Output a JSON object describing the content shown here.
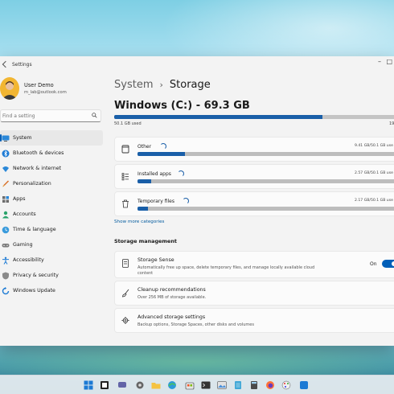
{
  "window": {
    "title": "Settings"
  },
  "user": {
    "name": "User Demo",
    "email": "m_lab@outlook.com"
  },
  "search": {
    "placeholder": "Find a setting"
  },
  "nav": [
    {
      "label": "System",
      "icon": "monitor-icon"
    },
    {
      "label": "Bluetooth & devices",
      "icon": "bluetooth-icon"
    },
    {
      "label": "Network & internet",
      "icon": "wifi-icon"
    },
    {
      "label": "Personalization",
      "icon": "brush-icon"
    },
    {
      "label": "Apps",
      "icon": "apps-icon"
    },
    {
      "label": "Accounts",
      "icon": "person-icon"
    },
    {
      "label": "Time & language",
      "icon": "globe-clock-icon"
    },
    {
      "label": "Gaming",
      "icon": "gamepad-icon"
    },
    {
      "label": "Accessibility",
      "icon": "accessibility-icon"
    },
    {
      "label": "Privacy & security",
      "icon": "shield-icon"
    },
    {
      "label": "Windows Update",
      "icon": "update-icon"
    }
  ],
  "breadcrumb": {
    "parent": "System",
    "separator": "›",
    "current": "Storage"
  },
  "drive": {
    "title": "Windows (C:) - 69.3 GB",
    "used_label": "50.1 GB used",
    "total_label": "19",
    "used_fraction": 0.72
  },
  "categories": [
    {
      "label": "Other",
      "size": "9.41 GB/50.1 GB use",
      "fraction": 0.18,
      "icon": "folder-icon"
    },
    {
      "label": "Installed apps",
      "size": "2.57 GB/50.1 GB use",
      "fraction": 0.05,
      "icon": "list-icon"
    },
    {
      "label": "Temporary files",
      "size": "2.17 GB/50.1 GB use",
      "fraction": 0.04,
      "icon": "trash-icon"
    }
  ],
  "show_more": "Show more categories",
  "management": {
    "heading": "Storage management",
    "items": [
      {
        "title": "Storage Sense",
        "desc": "Automatically free up space, delete temporary files, and manage locally available cloud content",
        "toggle_label": "On",
        "icon": "storage-icon"
      },
      {
        "title": "Cleanup recommendations",
        "desc": "Over 256 MB of storage available.",
        "icon": "broom-icon"
      },
      {
        "title": "Advanced storage settings",
        "desc": "Backup options, Storage Spaces, other disks and volumes",
        "icon": "gear-icon"
      }
    ]
  },
  "colors": {
    "accent": "#005fb8",
    "bar_fill": "#1a5fa8",
    "bar_track": "#c4c4c4"
  }
}
